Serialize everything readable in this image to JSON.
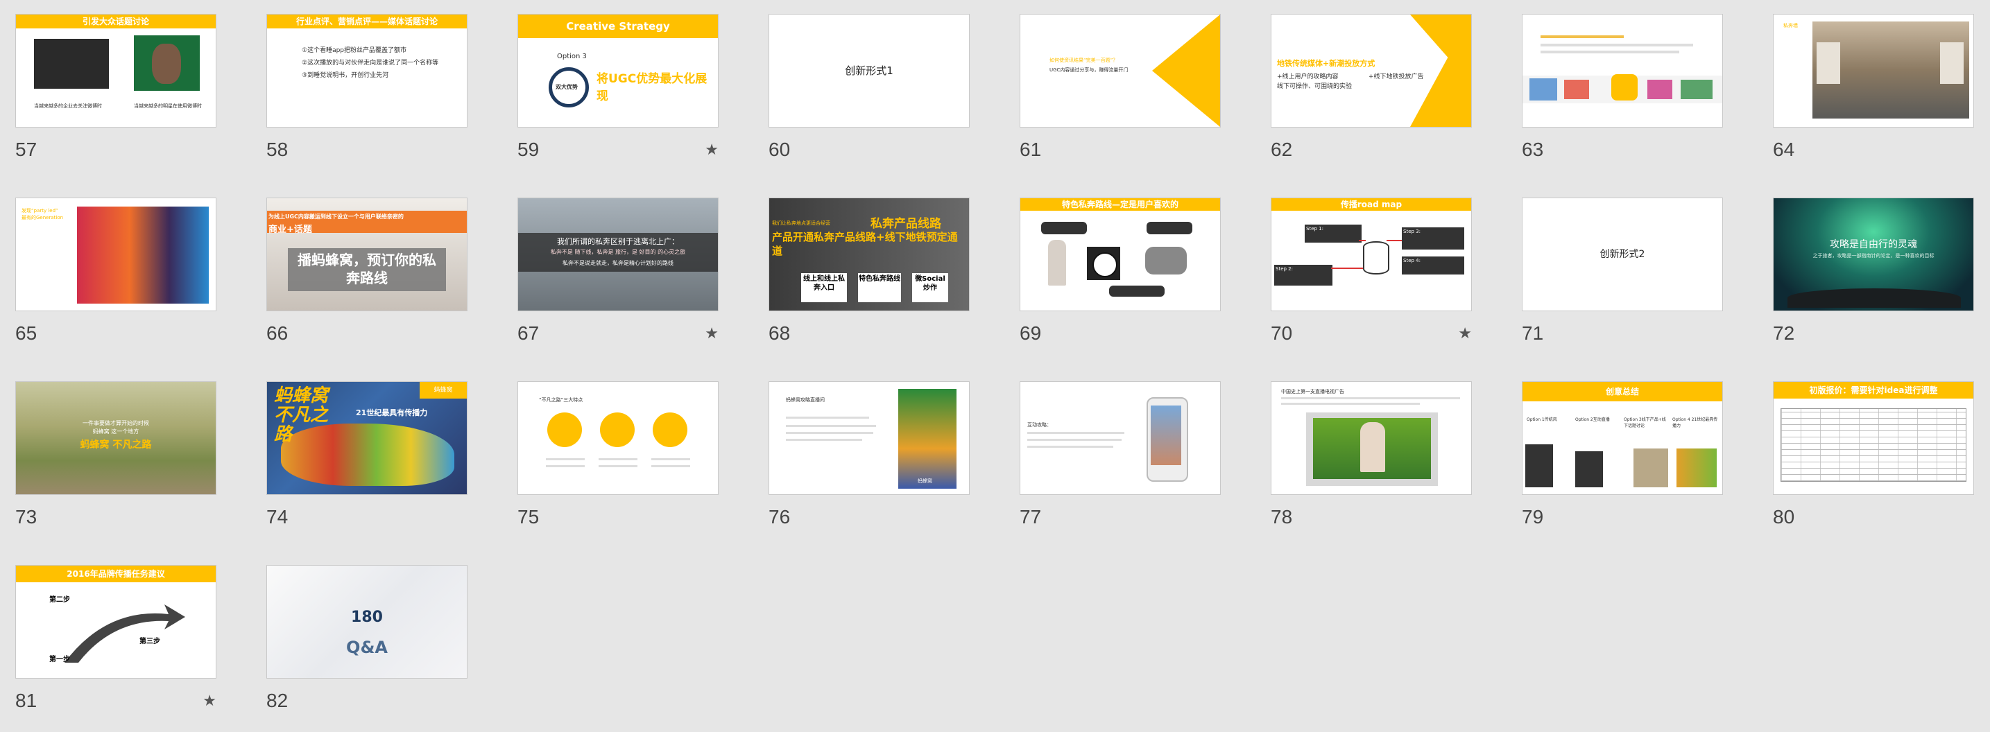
{
  "slides": [
    {
      "n": "57",
      "title": "引发大众话题讨论",
      "cap_a": "当越来越多的企业去关注微博时",
      "cap_b": "当越来越多的明星在使用微博时",
      "starred": false
    },
    {
      "n": "58",
      "title": "行业点评、营销点评——媒体话题讨论",
      "lines": [
        "①这个看睡app把粉丝产品覆盖了额市",
        "②这次播放的与对伙伴走向是谁说了同一个名称等",
        "③到睡觉说明书，开创行业先河"
      ],
      "starred": false
    },
    {
      "n": "59",
      "header": "Creative  Strategy",
      "option": "Option 3",
      "badge": "双大优势",
      "headline": "将UGC优势最大化展现",
      "starred": true
    },
    {
      "n": "60",
      "text": "创新形式1",
      "starred": false
    },
    {
      "n": "61",
      "text_a": "如何使资讯结果“完美一百题”？",
      "text_b": "UGC内容通过分享与，赚得流量开门",
      "starred": false
    },
    {
      "n": "62",
      "head": "地铁传统媒体+新潮投放方式",
      "line_a": "+线上用户的攻略内容",
      "line_b": "+线下地铁投放广告",
      "line_c": "线下可操作、可围绕的实验",
      "starred": false
    },
    {
      "n": "63",
      "starred": false
    },
    {
      "n": "64",
      "label": "私奔墙",
      "starred": false
    },
    {
      "n": "65",
      "label_a": "发现“party led”",
      "label_b": "最有的Generation",
      "starred": false
    },
    {
      "n": "66",
      "banner": "为线上UGC内容搬运到线下设立一个与用户联络亲密的",
      "banner2": "商业+话题",
      "text": "播蚂蜂窝，预订你的私奔路线",
      "starred": false
    },
    {
      "n": "67",
      "line_a": "我们所谓的私奔区别于逃离北上广：",
      "line_b": "私奔不是 随下线，私奔是 旅行，是 好目的 的心灵之旅",
      "line_c": "私奔不是说走就走，私奔是精心计划好的路线",
      "starred": true
    },
    {
      "n": "68",
      "top": "我们让私奔地点更适合经营",
      "title": "私奔产品线路",
      "sub": "产品开通私奔产品线路+线下地铁预定通道",
      "box_a": "线上和线上私奔入口",
      "box_b": "特色私奔路线",
      "box_c": "微Social炒作",
      "starred": false
    },
    {
      "n": "69",
      "title": "特色私奔路线—定是用户喜欢的",
      "starred": false
    },
    {
      "n": "70",
      "title": "传播road map",
      "step1": "Step 1:",
      "step2": "Step 2:",
      "step3": "Step 3:",
      "step4": "Step 4:",
      "starred": true
    },
    {
      "n": "71",
      "text": "创新形式2",
      "starred": false
    },
    {
      "n": "72",
      "title": "攻略是自由行的灵魂",
      "sub": "之于旅者，攻略是一部指南针的论定，是一种喜欢的目标",
      "starred": false
    },
    {
      "n": "73",
      "line_a": "一件事要做才算开始的时候",
      "line_b": "蚂蜂窝 这一个地方",
      "line_c": "蚂蜂窝 不凡之路",
      "starred": false
    },
    {
      "n": "74",
      "title": "蚂蜂窝不凡之路",
      "sub": "21世纪最具有传播力",
      "logo": "蚂蜂窝",
      "starred": false
    },
    {
      "n": "75",
      "head": "“不凡之路”三大特点",
      "starred": false
    },
    {
      "n": "76",
      "head": "蚂蜂窝攻略直播间",
      "tag": "蚂蜂窝",
      "starred": false
    },
    {
      "n": "77",
      "head": "互动攻略：",
      "starred": false
    },
    {
      "n": "78",
      "head": "中国史上第一支直播电视广告",
      "starred": false
    },
    {
      "n": "79",
      "title": "创意总结",
      "cols": [
        "Option 1传统风",
        "Option 2互动直播",
        "Option 3线下产品+线下话题讨论",
        "Option 4 21世纪最具传播力"
      ],
      "starred": false
    },
    {
      "n": "80",
      "title": "初版报价：需要针对idea进行调整",
      "starred": false
    },
    {
      "n": "81",
      "title": "2016年品牌传播任务建议",
      "s1": "第一步",
      "s2": "第二步",
      "s3": "第三步",
      "starred": true
    },
    {
      "n": "82",
      "logo": "180",
      "text": "Q&A",
      "starred": false
    }
  ],
  "star_glyph": "★",
  "colors": {
    "accent": "#ffc000",
    "bg": "#e6e6e6",
    "red": "#e53b2c",
    "navy": "#1e3a5f"
  }
}
